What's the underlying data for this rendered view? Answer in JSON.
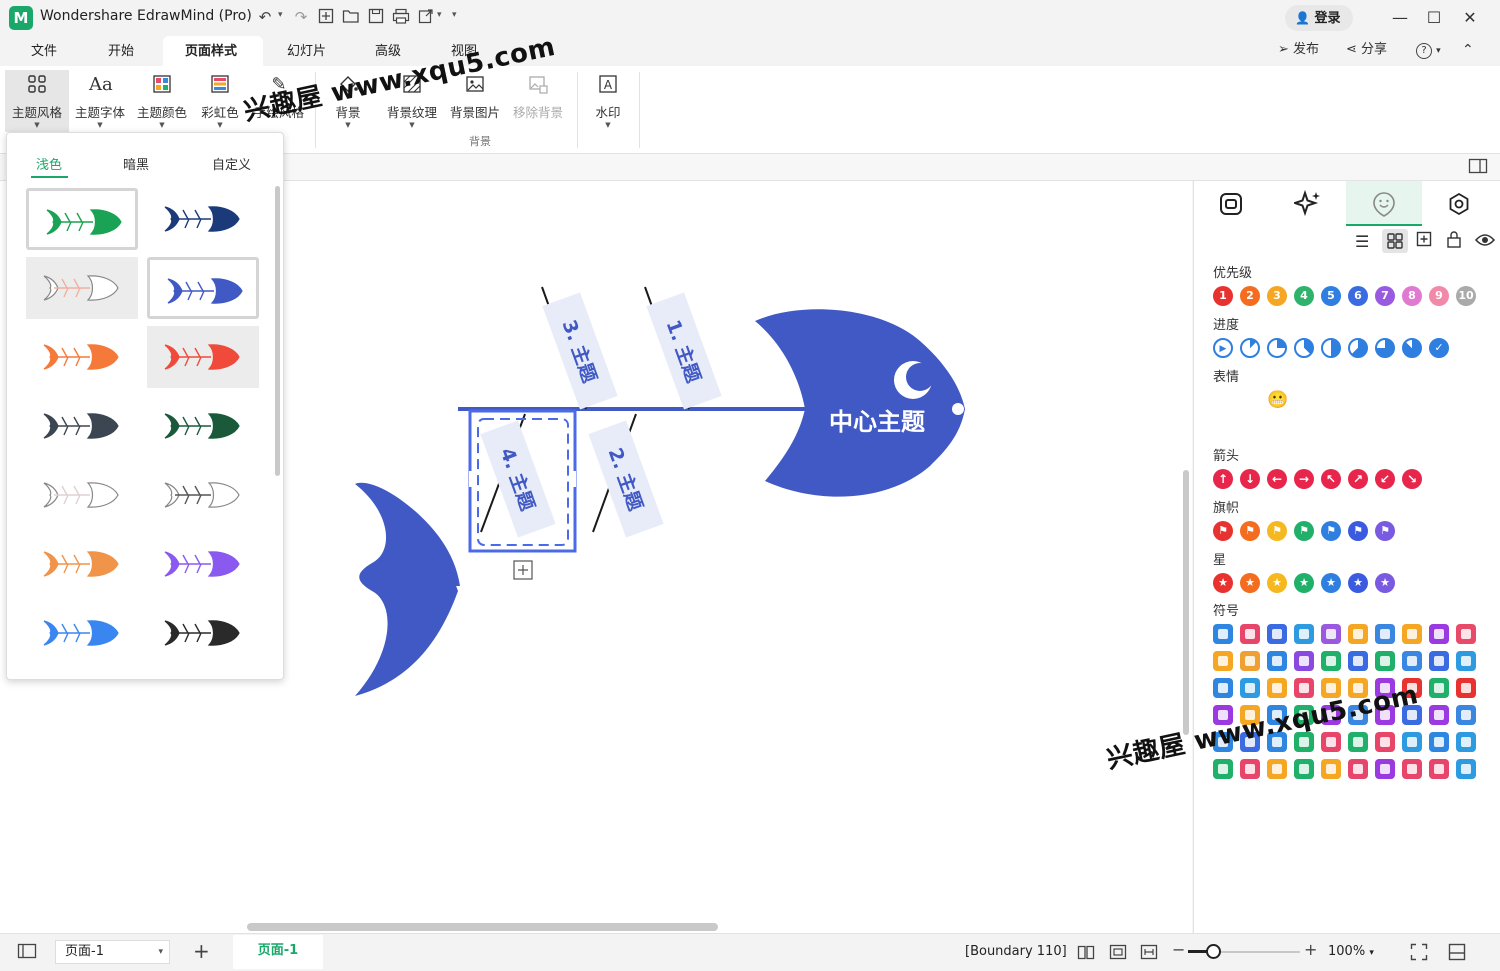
{
  "app": {
    "title": "Wondershare EdrawMind (Pro)",
    "logo": "M"
  },
  "titlebar": {
    "login": "登录",
    "quick_icons": [
      "undo-icon",
      "redo-icon",
      "new-file-icon",
      "open-folder-icon",
      "save-icon",
      "print-icon",
      "export-icon",
      "customize-icon"
    ]
  },
  "menu": {
    "tabs": [
      "文件",
      "开始",
      "页面样式",
      "幻灯片",
      "高级",
      "视图"
    ],
    "active": "页面样式",
    "publish": "发布",
    "share": "分享",
    "help": "?"
  },
  "ribbon": {
    "buttons": [
      {
        "label": "主题风格",
        "icon": "grid-icon"
      },
      {
        "label": "主题字体",
        "icon": "font-icon"
      },
      {
        "label": "主题颜色",
        "icon": "palette-icon"
      },
      {
        "label": "彩虹色",
        "icon": "rainbow-icon"
      },
      {
        "label": "手绘风格",
        "icon": "pencil-icon"
      },
      {
        "label": "背景",
        "icon": "fill-bucket-icon"
      },
      {
        "label": "背景纹理",
        "icon": "texture-icon"
      },
      {
        "label": "背景图片",
        "icon": "image-icon"
      },
      {
        "label": "移除背景",
        "icon": "remove-image-icon"
      },
      {
        "label": "水印",
        "icon": "watermark-icon"
      }
    ],
    "group_label": "背景"
  },
  "theme_dropdown": {
    "tabs": [
      "浅色",
      "暗黑",
      "自定义"
    ],
    "active_tab": "浅色",
    "thumbnails": [
      {
        "head": "#1aa354",
        "bones": "#1aa354"
      },
      {
        "head": "#1b3a7a",
        "bones": "#1b3a7a"
      },
      {
        "head": "#ffffff",
        "bones": "#f0b0a0"
      },
      {
        "head": "#4059c4",
        "bones": "#4059c4"
      },
      {
        "head": "#f57a3a",
        "bones": "#f57a3a"
      },
      {
        "head": "#f04a3a",
        "bones": "#f04a3a"
      },
      {
        "head": "#3c4652",
        "bones": "#3c4652"
      },
      {
        "head": "#1a5a3a",
        "bones": "#1a5a3a"
      },
      {
        "head": "#ffffff",
        "bones": "#e0d0d0"
      },
      {
        "head": "#ffffff",
        "bones": "#555555"
      },
      {
        "head": "#f0944a",
        "bones": "#f0944a"
      },
      {
        "head": "#8a5af0",
        "bones": "#8a5af0"
      },
      {
        "head": "#3a86f0",
        "bones": "#3a86f0"
      },
      {
        "head": "#2a2a2a",
        "bones": "#2a2a2a"
      }
    ]
  },
  "diagram": {
    "center": "中心主题",
    "fish_color": "#4059c4",
    "topics": [
      "1. 主题",
      "2. 主题",
      "3. 主题",
      "4. 主题"
    ]
  },
  "right_panel": {
    "tabs": [
      "style-icon",
      "ai-magic-icon",
      "mark-icon",
      "settings-icon"
    ],
    "active_tab": 2,
    "toolbar": [
      "list-icon",
      "grid-icon",
      "add-mark-icon",
      "lock-icon",
      "eye-icon"
    ],
    "sections": [
      {
        "title": "优先级",
        "items": [
          "1",
          "2",
          "3",
          "4",
          "5",
          "6",
          "7",
          "8",
          "9",
          "10"
        ],
        "colors": [
          "#e8322f",
          "#f36c1f",
          "#f5a623",
          "#2fb36c",
          "#2e7fe0",
          "#3a6be0",
          "#9a5ae0",
          "#e07ad0",
          "#f08aa8",
          "#aaaaaa"
        ]
      },
      {
        "title": "进度",
        "count": 9,
        "color": "#2e7fe0"
      },
      {
        "title": "表情",
        "emojis": [
          "😊",
          "😄",
          "😬",
          "😟",
          "😡",
          "😭",
          "😁",
          "😲",
          "😒",
          "😨",
          "😷",
          "😆",
          "😋",
          "😍"
        ]
      },
      {
        "title": "箭头",
        "items": [
          "↑",
          "↓",
          "←",
          "→",
          "↖",
          "↗",
          "↙",
          "↘"
        ],
        "color": "#e8254a"
      },
      {
        "title": "旗帜",
        "colors": [
          "#e8322f",
          "#f36c1f",
          "#f5b81f",
          "#20b06a",
          "#2e7fe0",
          "#3a5ae0",
          "#7a5ae0"
        ]
      },
      {
        "title": "星",
        "colors": [
          "#e8322f",
          "#f36c1f",
          "#f5b81f",
          "#20b06a",
          "#2e7fe0",
          "#3a5ae0",
          "#7a5ae0"
        ]
      },
      {
        "title": "符号"
      }
    ],
    "symbol_colors": [
      [
        "#2e86e0",
        "#e8456a",
        "#3a6be0",
        "#2e9ae0",
        "#9a5ae0",
        "#f5a623",
        "#3a86e0",
        "#f5a623",
        "#9a3ae0",
        "#e84a6a"
      ],
      [
        "#f5a623",
        "#f0a030",
        "#2e86e0",
        "#8a4ae0",
        "#20b06a",
        "#3a6be0",
        "#20b06a",
        "#3a86e0",
        "#3a6be0",
        "#2e9ae0"
      ],
      [
        "#2e86e0",
        "#2e9ae0",
        "#f5a623",
        "#e8456a",
        "#f5a623",
        "#f5a623",
        "#9a3ae0",
        "#e8322f",
        "#20b06a",
        "#e8322f"
      ],
      [
        "#9a3ae0",
        "#f5a623",
        "#2e86e0",
        "#20b06a",
        "#9a3ae0",
        "#3a86e0",
        "#9a3ae0",
        "#3a6be0",
        "#9a3ae0",
        "#3a86e0"
      ],
      [
        "#2e86e0",
        "#3a6be0",
        "#2e86e0",
        "#20b06a",
        "#e8456a",
        "#20b06a",
        "#e8456a",
        "#2e9ae0",
        "#2e86e0",
        "#2e9ae0"
      ],
      [
        "#20b06a",
        "#e8456a",
        "#f5a623",
        "#20b06a",
        "#f5a623",
        "#e8456a",
        "#9a3ae0",
        "#e8456a",
        "#e8456a",
        "#2e9ae0"
      ]
    ]
  },
  "statusbar": {
    "page_selector": "页面-1",
    "page_tab": "页面-1",
    "boundary": "[Boundary 110]",
    "zoom": "100%",
    "zoom_level": 0.22
  },
  "watermark": "兴趣屋 www.xqu5.com"
}
